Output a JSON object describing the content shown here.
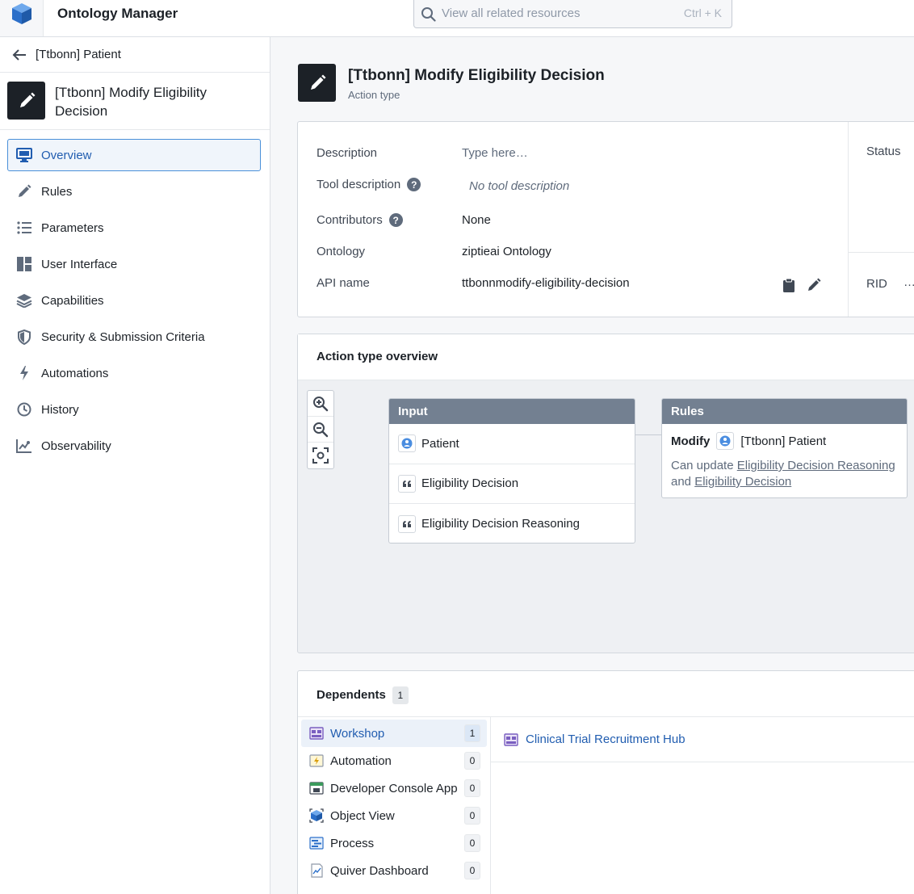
{
  "app": {
    "title": "Ontology Manager"
  },
  "search": {
    "placeholder": "View all related resources",
    "shortcut": "Ctrl + K"
  },
  "sidebar": {
    "back_label": "[Ttbonn] Patient",
    "entity_name": "[Ttbonn] Modify Eligibility Decision",
    "items": [
      {
        "label": "Overview",
        "icon": "monitor-icon"
      },
      {
        "label": "Rules",
        "icon": "pencil-icon"
      },
      {
        "label": "Parameters",
        "icon": "list-icon"
      },
      {
        "label": "User Interface",
        "icon": "layout-icon"
      },
      {
        "label": "Capabilities",
        "icon": "layers-icon"
      },
      {
        "label": "Security & Submission Criteria",
        "icon": "shield-icon"
      },
      {
        "label": "Automations",
        "icon": "lightning-icon"
      },
      {
        "label": "History",
        "icon": "clock-icon"
      },
      {
        "label": "Observability",
        "icon": "chart-icon"
      }
    ]
  },
  "header": {
    "title": "[Ttbonn] Modify Eligibility Decision",
    "subtitle": "Action type"
  },
  "properties": {
    "description_label": "Description",
    "description_placeholder": "Type here…",
    "tool_description_label": "Tool description",
    "tool_description_value": "No tool description",
    "contributors_label": "Contributors",
    "contributors_value": "None",
    "ontology_label": "Ontology",
    "ontology_value": "ziptieai Ontology",
    "api_name_label": "API name",
    "api_name_value": "ttbonnmodify-eligibility-decision",
    "status_label": "Status",
    "rid_label": "RID",
    "rid_value": "…"
  },
  "overview": {
    "title": "Action type overview",
    "input": {
      "header": "Input",
      "rows": [
        "Patient",
        "Eligibility Decision",
        "Eligibility Decision Reasoning"
      ]
    },
    "rules": {
      "header": "Rules",
      "verb": "Modify",
      "object": "[Ttbonn] Patient",
      "desc_prefix": "Can update",
      "link1": "Eligibility Decision Reasoning",
      "desc_and": "and",
      "link2": "Eligibility Decision"
    }
  },
  "dependents": {
    "title": "Dependents",
    "count": "1",
    "items": [
      {
        "label": "Workshop",
        "count": "1"
      },
      {
        "label": "Automation",
        "count": "0"
      },
      {
        "label": "Developer Console App",
        "count": "0"
      },
      {
        "label": "Object View",
        "count": "0"
      },
      {
        "label": "Process",
        "count": "0"
      },
      {
        "label": "Quiver Dashboard",
        "count": "0"
      }
    ],
    "result": "Clinical Trial Recruitment Hub"
  },
  "colors": {
    "accent": "#215db0",
    "node_header": "#738091",
    "active_border": "#4a90d9"
  }
}
